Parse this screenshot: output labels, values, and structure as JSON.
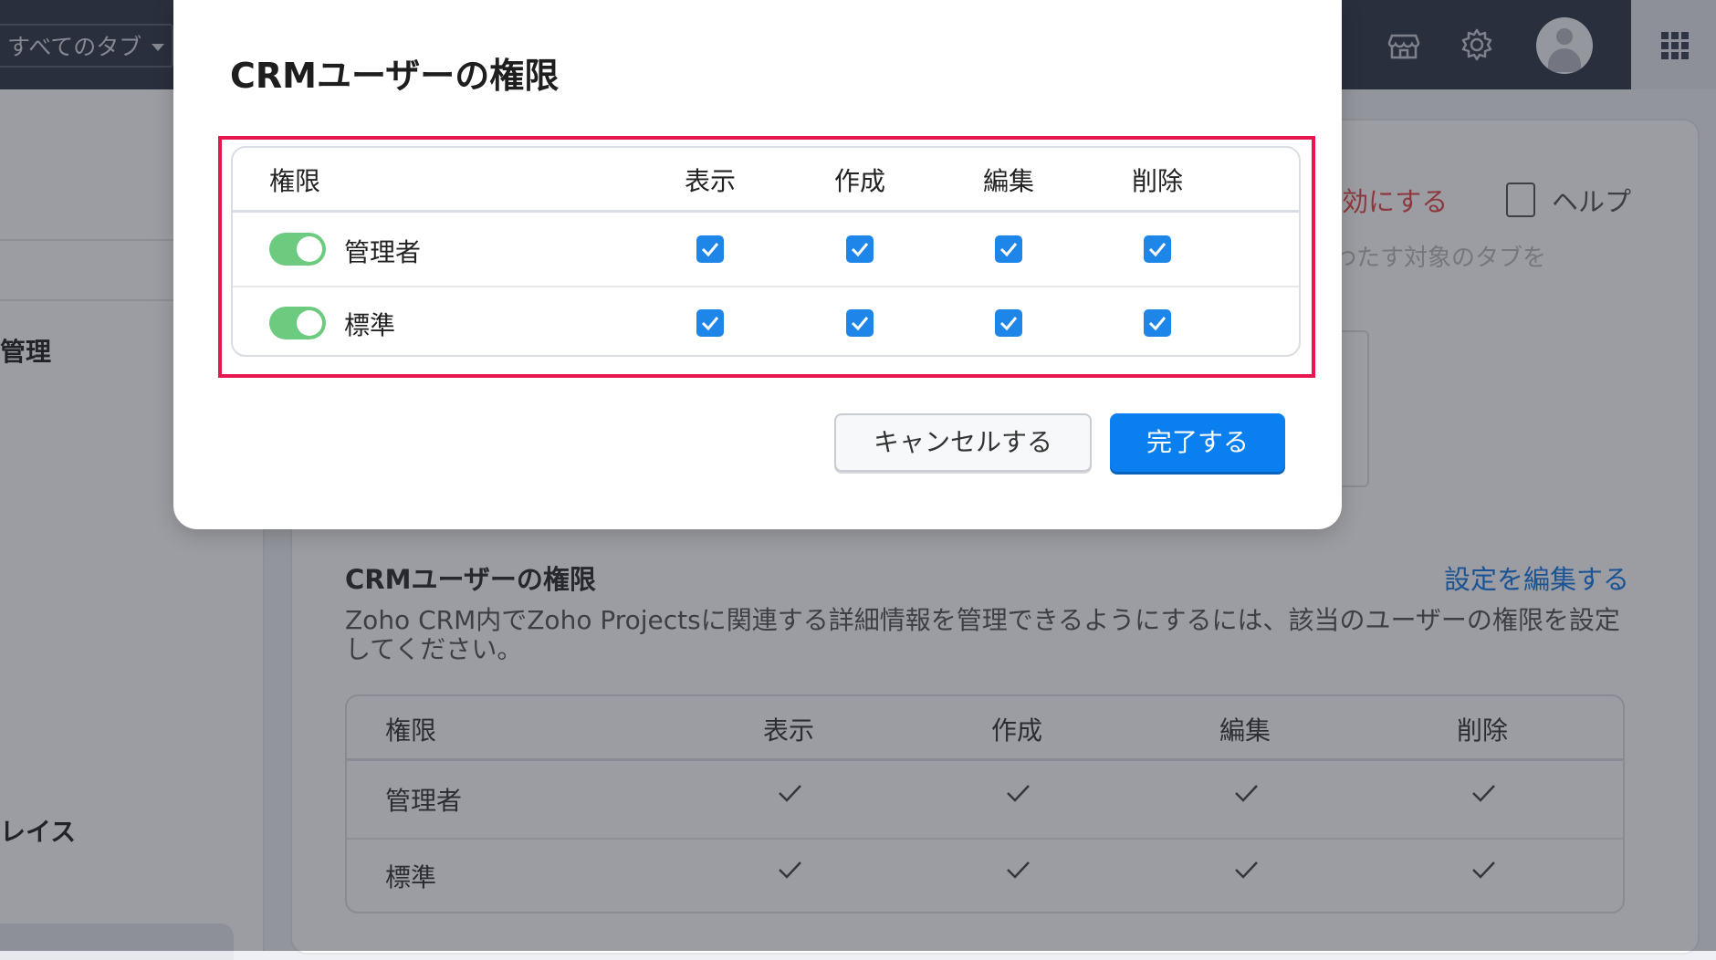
{
  "topbar": {
    "tabs_select_label": "すべてのタブ",
    "icons": [
      "marketplace-icon",
      "gear-icon",
      "avatar",
      "apps-grid-icon"
    ]
  },
  "sidebar": {
    "item_manage": "管理",
    "item_place": "レイス"
  },
  "background": {
    "red_link": "効にする",
    "help_label": "ヘルプ",
    "faint_text": "わたす対象のタブを",
    "section_title": "CRMユーザーの権限",
    "edit_link": "設定を編集する",
    "description": "Zoho CRM内でZoho Projectsに関連する詳細情報を管理できるようにするには、該当のユーザーの権限を設定してください。",
    "table": {
      "headers": [
        "権限",
        "表示",
        "作成",
        "編集",
        "削除"
      ],
      "rows": [
        {
          "label": "管理者"
        },
        {
          "label": "標準"
        }
      ]
    }
  },
  "modal": {
    "title": "CRMユーザーの権限",
    "table": {
      "headers": [
        "権限",
        "表示",
        "作成",
        "編集",
        "削除"
      ],
      "rows": [
        {
          "label": "管理者",
          "enabled": true,
          "view": true,
          "create": true,
          "edit": true,
          "delete": true
        },
        {
          "label": "標準",
          "enabled": true,
          "view": true,
          "create": true,
          "edit": true,
          "delete": true
        }
      ]
    },
    "cancel_label": "キャンセルする",
    "done_label": "完了する",
    "colors": {
      "highlight": "#e8164f",
      "toggle_on": "#6ccb7e",
      "checkbox": "#1e86e8",
      "primary": "#0a7ff0"
    }
  }
}
